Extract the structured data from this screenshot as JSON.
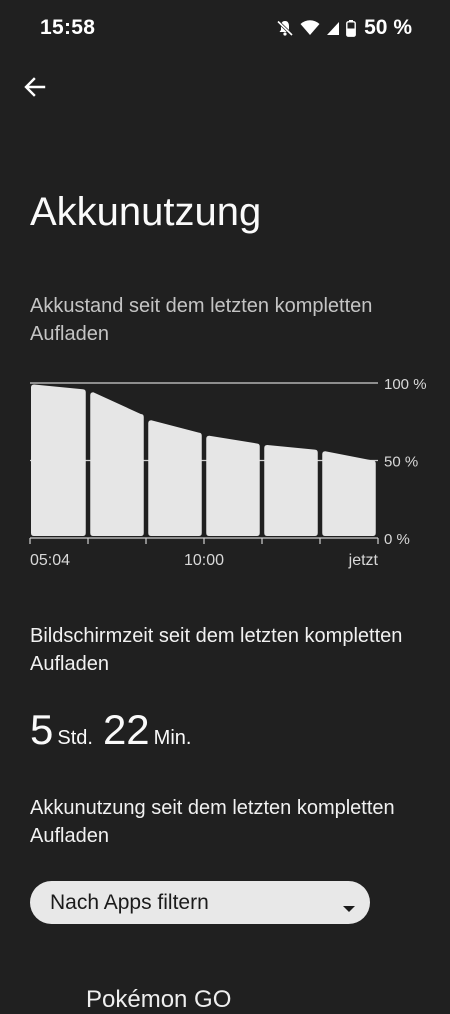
{
  "status_bar": {
    "time": "15:58",
    "battery_percent": "50 %",
    "icons": [
      "mute-icon",
      "wifi-icon",
      "cellular-signal-icon",
      "battery-icon"
    ]
  },
  "toolbar": {
    "back_icon": "arrow-left-icon"
  },
  "page": {
    "title": "Akkunutzung"
  },
  "chart": {
    "caption": "Akkustand seit dem letzten kompletten Aufladen"
  },
  "chart_data": {
    "type": "bar",
    "categories": [
      "05:04",
      "",
      "10:00",
      "",
      "",
      "jetzt"
    ],
    "series": [
      {
        "values": [
          [
            99,
            96
          ],
          [
            94,
            80
          ],
          [
            76,
            68
          ],
          [
            66,
            61
          ],
          [
            60,
            57
          ],
          [
            56,
            50
          ]
        ]
      }
    ],
    "x_tick_labels": [
      "05:04",
      "10:00",
      "jetzt"
    ],
    "y_tick_labels": [
      "100 %",
      "50 %",
      "0 %"
    ],
    "ylim": [
      0,
      100
    ],
    "grid": true,
    "colors": {
      "bar": "#e6e6e6",
      "grid": "#d0d0d0"
    }
  },
  "screen_time": {
    "heading": "Bildschirmzeit seit dem letzten kompletten Aufladen",
    "hours": "5",
    "hours_unit": "Std.",
    "minutes": "22",
    "minutes_unit": "Min."
  },
  "usage": {
    "heading": "Akkunutzung seit dem letzten kompletten Aufladen",
    "filter_label": "Nach Apps filtern",
    "filter_icon": "dropdown-arrow-icon"
  },
  "apps": [
    {
      "name": "Pokémon GO"
    }
  ],
  "colors": {
    "background": "#202020",
    "dropdown_bg": "#e8e8e8"
  }
}
